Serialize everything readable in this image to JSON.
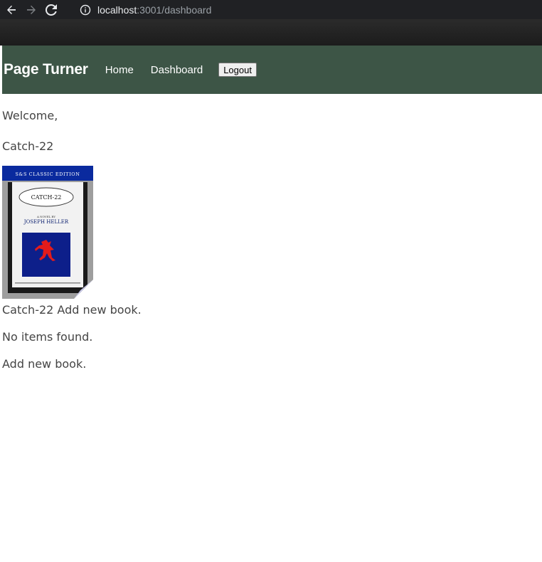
{
  "browser": {
    "url_host": "localhost",
    "url_rest": ":3001/dashboard"
  },
  "nav": {
    "brand": "Page Turner",
    "links": [
      "Home",
      "Dashboard"
    ],
    "logout_label": "Logout",
    "bg_color": "#3d5546"
  },
  "main": {
    "welcome": "Welcome,",
    "book_title": "Catch-22",
    "cover": {
      "band_text": "S&S CLASSIC EDITION",
      "title": "CATCH-22",
      "subtitle": "A NOVEL BY",
      "author": "JOSEPH HELLER"
    },
    "cover_caption": "Catch-22 Add new book.",
    "empty_message": "No items found.",
    "add_link": "Add new book."
  }
}
